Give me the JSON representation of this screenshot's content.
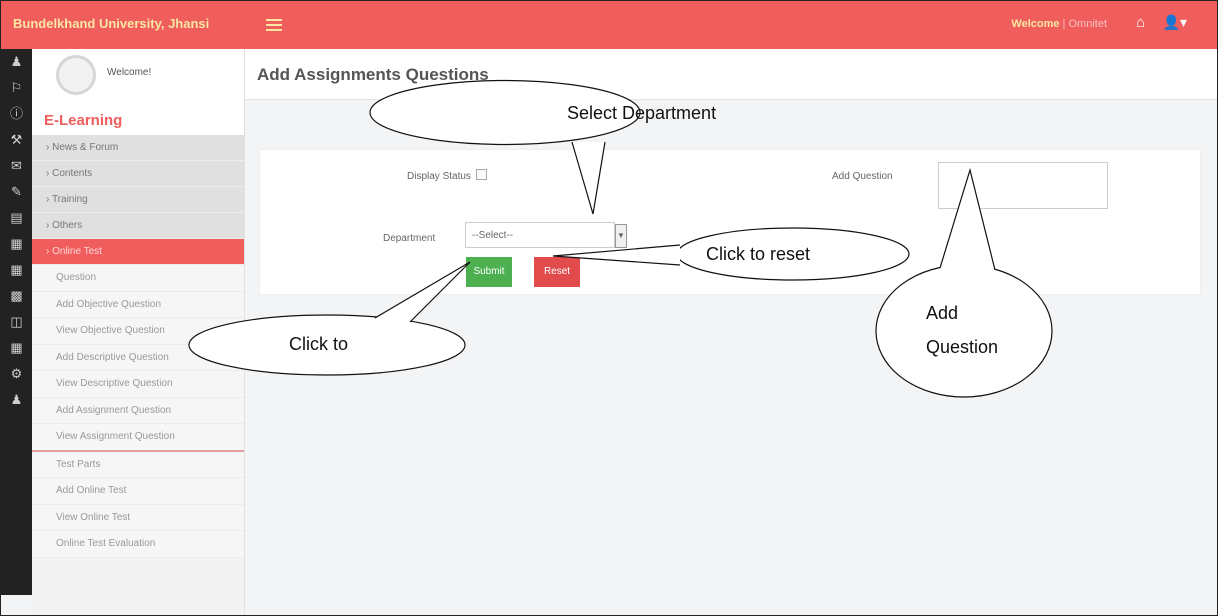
{
  "header": {
    "brand": "Bundelkhand University, Jhansi",
    "welcome_label": "Welcome",
    "welcome_sep": " | ",
    "welcome_user": "Omnitet",
    "home_icon": "home-icon",
    "user_icon": "user-icon"
  },
  "sidebar": {
    "welcome": "Welcome!",
    "section_title": "E-Learning",
    "menu": [
      {
        "label": "News & Forum"
      },
      {
        "label": "Contents"
      },
      {
        "label": "Training"
      },
      {
        "label": "Others"
      },
      {
        "label": "Online Test"
      }
    ],
    "sub_items": [
      {
        "label": "Question"
      },
      {
        "label": "Add Objective Question"
      },
      {
        "label": "View Objective Question"
      },
      {
        "label": "Add Descriptive Question"
      },
      {
        "label": "View Descriptive Question"
      },
      {
        "label": "Add Assignment Question"
      },
      {
        "label": "View Assignment Question"
      },
      {
        "label": "Test Parts"
      },
      {
        "label": "Add Online Test"
      },
      {
        "label": "View Online Test"
      },
      {
        "label": "Online Test Evaluation"
      }
    ]
  },
  "main": {
    "title": "Add Assignments Questions",
    "form": {
      "display_status_label": "Display Status",
      "department_label": "Department",
      "department_value": "--Select--",
      "add_question_label": "Add Question",
      "submit_label": "Submit",
      "reset_label": "Reset"
    }
  },
  "callouts": {
    "select_department": "Select Department",
    "click_to_reset": "Click to reset",
    "click_to": "Click to",
    "add_question_line1": "Add",
    "add_question_line2": "Question"
  },
  "colors": {
    "topbar": "#ef5d5d",
    "brand_text": "#fbe7a2",
    "submit_button": "#4caf50",
    "reset_button": "#e14b4b",
    "icon_rail": "#222222"
  }
}
